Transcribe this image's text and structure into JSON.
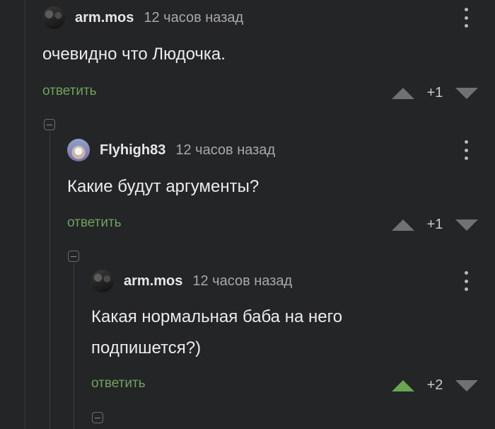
{
  "comments": [
    {
      "username": "arm.mos",
      "timestamp": "12 часов назад",
      "text": "очевидно что Людочка.",
      "reply_label": "ответить",
      "score": "+1",
      "avatar": "dark-photo-avatar"
    },
    {
      "username": "Flyhigh83",
      "timestamp": "12 часов назад",
      "text": "Какие будут аргументы?",
      "reply_label": "ответить",
      "score": "+1",
      "avatar": "wolf-avatar"
    },
    {
      "username": "arm.mos",
      "timestamp": "12 часов назад",
      "text_line1": "Какая нормальная баба на него",
      "text_line2": "подпишется?)",
      "reply_label": "ответить",
      "score": "+2",
      "upvoted": true,
      "avatar": "dark-photo-avatar"
    }
  ],
  "colors": {
    "background": "#232527",
    "reply_link": "#6fa35a",
    "upvote_active": "#69a552",
    "vote_inactive": "#6f7275"
  },
  "icons": [
    "collapse-icon",
    "more-options-icon",
    "upvote-icon",
    "downvote-icon"
  ]
}
